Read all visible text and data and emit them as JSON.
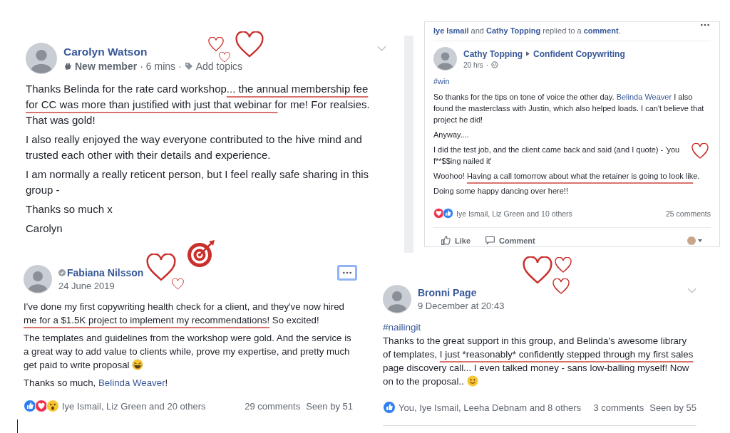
{
  "posts": [
    {
      "title": [
        {
          "kind": "name",
          "text": "Carolyn Watson"
        }
      ],
      "meta": [
        {
          "kind": "badge",
          "text": "New member"
        },
        {
          "kind": "sep",
          "text": "·"
        },
        {
          "kind": "time",
          "text": "6 mins"
        },
        {
          "kind": "sep",
          "text": "·"
        },
        {
          "kind": "topics",
          "text": "Add topics"
        }
      ],
      "menu": {
        "kind": "chevron"
      },
      "doodle": {
        "kind": "three_hearts"
      },
      "paragraphs": [
        [
          {
            "kind": "plain",
            "text": "Thanks Belinda for the rate card workshop"
          },
          {
            "kind": "marked",
            "text": "... the annual membership fee for CC was more than justified with just that webinar f"
          },
          {
            "kind": "plain",
            "text": "or me! For realsies. That was gold!"
          }
        ],
        [
          {
            "kind": "plain",
            "text": "I also really enjoyed the way everyone contributed to the hive mind and trusted each other with their details and experience."
          }
        ],
        [
          {
            "kind": "plain",
            "text": "I am normally a really reticent person, but I feel really safe sharing in this group -"
          }
        ],
        [
          {
            "kind": "plain",
            "text": "Thanks so much x"
          }
        ],
        [
          {
            "kind": "plain",
            "text": "Carolyn"
          }
        ]
      ]
    },
    {
      "notice": [
        {
          "kind": "link",
          "text": "Iye Ismail"
        },
        {
          "kind": "plain",
          "text": " and "
        },
        {
          "kind": "link",
          "text": "Cathy Topping"
        },
        {
          "kind": "plain",
          "text": " replied to a "
        },
        {
          "kind": "link",
          "text": "comment"
        },
        {
          "kind": "plain",
          "text": "."
        }
      ],
      "title": [
        {
          "kind": "name",
          "text": "Cathy Topping"
        },
        {
          "kind": "arrow"
        },
        {
          "kind": "name",
          "text": "Confident Copywriting"
        }
      ],
      "meta": [
        {
          "kind": "time",
          "text": "20 hrs"
        },
        {
          "kind": "sep",
          "text": "·"
        },
        {
          "kind": "globe"
        }
      ],
      "menu": {
        "kind": "dots"
      },
      "doodle": {
        "kind": "one_heart"
      },
      "hashtag": "#win",
      "paragraphs": [
        [
          {
            "kind": "plain",
            "text": "So thanks for the tips on tone of voice the other day. "
          },
          {
            "kind": "mention",
            "text": "Belinda Weaver"
          },
          {
            "kind": "plain",
            "text": " I also found the masterclass with Justin, which also helped loads. I can't believe that project he did!"
          }
        ],
        [
          {
            "kind": "plain",
            "text": "Anyway...."
          }
        ],
        [
          {
            "kind": "plain",
            "text": "I did the test job, and the client came back and said (and I quote) - 'you f**$$ing nailed it'"
          }
        ],
        [
          {
            "kind": "plain",
            "text": "Woohoo! "
          },
          {
            "kind": "marked",
            "text": "Having a call tomorrow about what the retainer is going to look lik"
          },
          {
            "kind": "plain",
            "text": "e."
          }
        ],
        [
          {
            "kind": "plain",
            "text": "Doing some happy dancing over here!!"
          }
        ]
      ],
      "reactions": [
        {
          "kind": "love"
        },
        {
          "kind": "like"
        }
      ],
      "reactors": "Iye Ismail, Liz Green and 10 others",
      "comments": "25 comments",
      "actions": [
        {
          "kind": "like",
          "text": "Like"
        },
        {
          "kind": "comment",
          "text": "Comment"
        },
        {
          "kind": "avatar_menu"
        }
      ]
    },
    {
      "title": [
        {
          "kind": "verified"
        },
        {
          "kind": "name",
          "text": "Fabiana Nilsson"
        }
      ],
      "meta": [
        {
          "kind": "time",
          "text": "24 June 2019"
        }
      ],
      "menu": {
        "kind": "dots_focused"
      },
      "doodle": {
        "kind": "hearts_target"
      },
      "paragraphs": [
        [
          {
            "kind": "plain",
            "text": "I've done my first copywriting health check for a client, and they've now hired "
          },
          {
            "kind": "marked",
            "text": "me for a $1.5K project to implement my recommendations!"
          },
          {
            "kind": "plain",
            "text": " So excited!"
          }
        ],
        [
          {
            "kind": "plain",
            "text": "The templates and guidelines from the workshop were gold. And the service is a great way to add value to clients while, prove my expertise, and pretty much get paid to write proposal "
          },
          {
            "kind": "emoji_laugh"
          }
        ],
        [
          {
            "kind": "plain",
            "text": "Thanks so much, "
          },
          {
            "kind": "mention",
            "text": "Belinda Weaver"
          },
          {
            "kind": "plain",
            "text": "!"
          }
        ]
      ],
      "reactions": [
        {
          "kind": "like"
        },
        {
          "kind": "love"
        },
        {
          "kind": "wow"
        }
      ],
      "reactors": "Iye Ismail, Liz Green and 20 others",
      "comments": "29 comments",
      "seen": "Seen by 51"
    },
    {
      "title": [
        {
          "kind": "name",
          "text": "Bronni Page"
        }
      ],
      "meta": [
        {
          "kind": "time",
          "text": "9 December at 20:43"
        }
      ],
      "menu": {
        "kind": "chevron"
      },
      "doodle": {
        "kind": "three_hearts_b"
      },
      "hashtag": "#nailingit",
      "paragraphs": [
        [
          {
            "kind": "plain",
            "text": "Thanks to the great support in this group, and Belinda's awesome library of templates, "
          },
          {
            "kind": "marked",
            "text": "I just *reasonably* confidently stepped through my first sales"
          },
          {
            "kind": "plain",
            "text": " page discovery call... I even talked money - sans low-balling myself! Now on to the proposal.. "
          },
          {
            "kind": "emoji_smile"
          }
        ]
      ],
      "reactions": [
        {
          "kind": "like"
        }
      ],
      "reactors": "You, Iye Ismail, Leeha Debnam and 8 others",
      "comments": "3 comments",
      "seen": "Seen by 55"
    }
  ]
}
